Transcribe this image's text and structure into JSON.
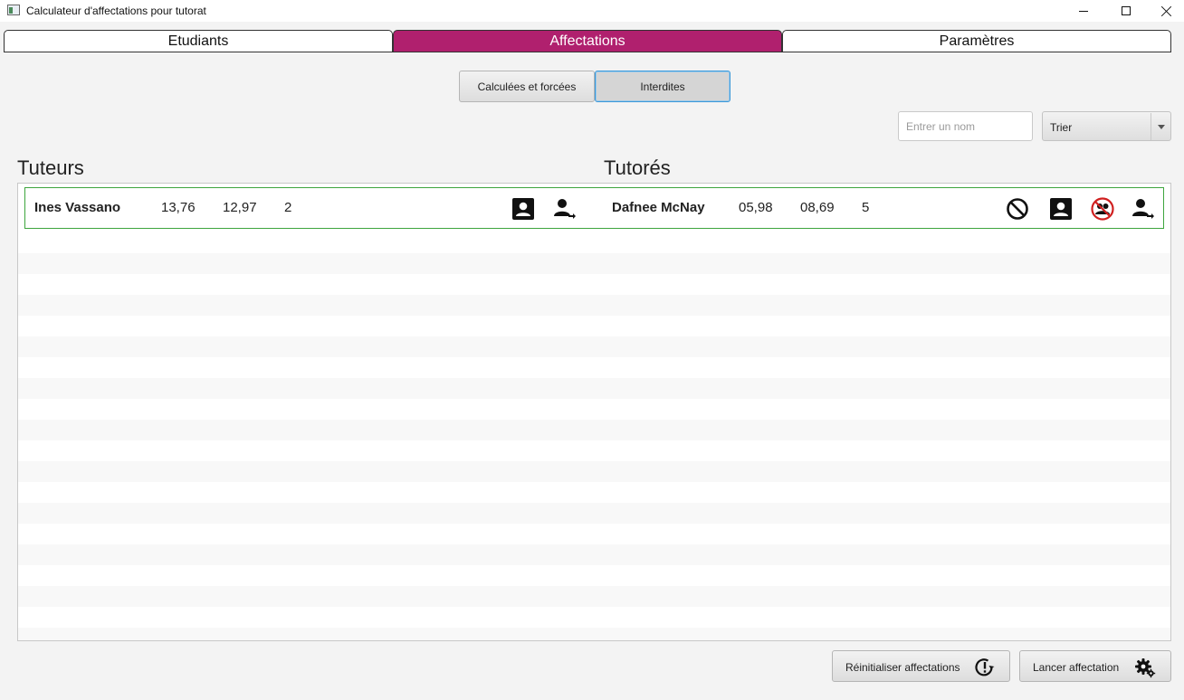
{
  "window": {
    "title": "Calculateur d'affectations pour tutorat"
  },
  "tabs": [
    {
      "label": "Etudiants",
      "active": false
    },
    {
      "label": "Affectations",
      "active": true
    },
    {
      "label": "Paramètres",
      "active": false
    }
  ],
  "view_toggle": {
    "options": [
      "Calculées et forcées",
      "Interdites"
    ],
    "selected": "Interdites"
  },
  "search": {
    "placeholder": "Entrer un nom",
    "value": ""
  },
  "sort": {
    "label": "Trier"
  },
  "headings": {
    "tutors": "Tuteurs",
    "tutees": "Tutorés"
  },
  "assignments": [
    {
      "tutor": {
        "name": "Ines Vassano",
        "v1": "13,76",
        "v2": "12,97",
        "v3": "2"
      },
      "tutee": {
        "name": "Dafnee McNay",
        "v1": "05,98",
        "v2": "08,69",
        "v3": "5"
      }
    }
  ],
  "actions": {
    "reset_label": "Réinitialiser affectations",
    "run_label": "Lancer affectation"
  },
  "colors": {
    "accent": "#b0206e",
    "row_border": "#3da53d",
    "forbidden_icon": "#d02020"
  },
  "icons": {
    "tutor_row": [
      "profile-card-icon",
      "assign-person-icon"
    ],
    "tutee_row": [
      "forbidden-icon",
      "profile-card-icon",
      "forbidden-group-icon",
      "assign-person-icon"
    ],
    "reset": "alert-rotate-icon",
    "run": "gear-icon"
  }
}
